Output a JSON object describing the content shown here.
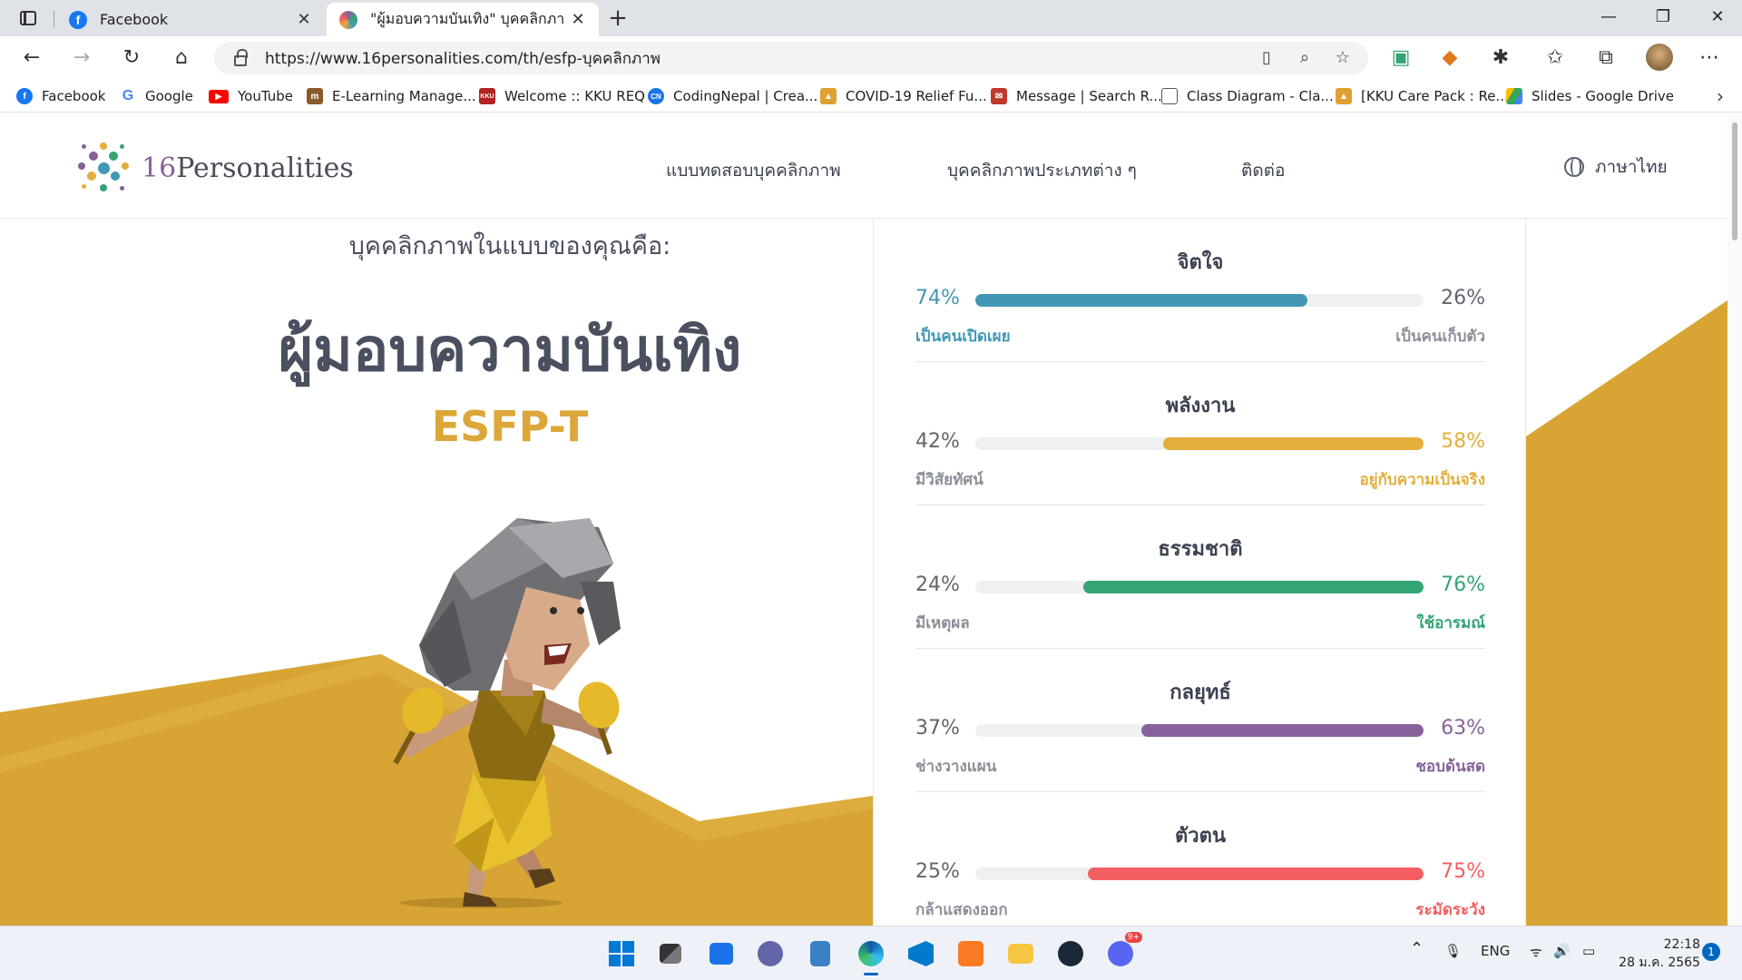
{
  "browser": {
    "tabs": [
      {
        "title": "Facebook",
        "active": false
      },
      {
        "title": "\"ผู้มอบความบันเทิง\" บุคคลิกภาพ (ESF",
        "active": true
      }
    ],
    "address": "https://www.16personalities.com/th/esfp-บุคคลิกภาพ",
    "bookmarks": [
      {
        "label": "Facebook",
        "icon": "facebook-icon",
        "color": "#1877f2"
      },
      {
        "label": "Google",
        "icon": "google-icon",
        "color": "#4285f4"
      },
      {
        "label": "YouTube",
        "icon": "youtube-icon",
        "color": "#ff0000"
      },
      {
        "label": "E-Learning Manage...",
        "icon": "elearning-icon",
        "color": "#8a5a2b"
      },
      {
        "label": "Welcome :: KKU REQ",
        "icon": "kku-req-icon",
        "color": "#b22222"
      },
      {
        "label": "CodingNepal | Crea...",
        "icon": "codingnepal-icon",
        "color": "#1a73e8"
      },
      {
        "label": "COVID-19 Relief Fu...",
        "icon": "covid-relief-icon",
        "color": "#e0a030"
      },
      {
        "label": "Message | Search R...",
        "icon": "message-icon",
        "color": "#c0392b"
      },
      {
        "label": "Class Diagram - Cla...",
        "icon": "document-icon",
        "color": "#666666"
      },
      {
        "label": "[KKU Care Pack : Re...",
        "icon": "kku-care-icon",
        "color": "#e0a030"
      },
      {
        "label": "Slides - Google Drive",
        "icon": "google-drive-icon",
        "color": "#34a853"
      }
    ]
  },
  "site": {
    "logo_number": "16",
    "logo_word": "Personalities",
    "nav": [
      "แบบทดสอบบุคคลิกภาพ",
      "บุคคลิกภาพประเภทต่าง ๆ",
      "ติดต่อ"
    ],
    "language": "ภาษาไทย",
    "intro": "บุคคลิกภาพในแบบของคุณคือ:",
    "type_name": "ผู้มอบความบันเทิง",
    "type_code": "ESFP-T",
    "accent": "#dca639"
  },
  "traits": [
    {
      "title": "จิตใจ",
      "left_pct": "74%",
      "right_pct": "26%",
      "left_label": "เป็นคนเปิดเผย",
      "right_label": "เป็นคนเก็บตัว",
      "fill_side": "left",
      "fill_fraction": 0.74,
      "color": "#4298b4",
      "highlight": "left"
    },
    {
      "title": "พลังงาน",
      "left_pct": "42%",
      "right_pct": "58%",
      "left_label": "มีวิสัยทัศน์",
      "right_label": "อยู่กับความเป็นจริง",
      "fill_side": "right",
      "fill_fraction": 0.58,
      "color": "#e4ae3a",
      "highlight": "right"
    },
    {
      "title": "ธรรมชาติ",
      "left_pct": "24%",
      "right_pct": "76%",
      "left_label": "มีเหตุผล",
      "right_label": "ใช้อารมณ์",
      "fill_side": "right",
      "fill_fraction": 0.76,
      "color": "#33a474",
      "highlight": "right"
    },
    {
      "title": "กลยุทธ์",
      "left_pct": "37%",
      "right_pct": "63%",
      "left_label": "ช่างวางแผน",
      "right_label": "ชอบด้นสด",
      "fill_side": "right",
      "fill_fraction": 0.63,
      "color": "#88619a",
      "highlight": "right"
    },
    {
      "title": "ตัวตน",
      "left_pct": "25%",
      "right_pct": "75%",
      "left_label": "กล้าแสดงออก",
      "right_label": "ระมัดระวัง",
      "fill_side": "right",
      "fill_fraction": 0.75,
      "color": "#f25e62",
      "highlight": "right"
    }
  ],
  "taskbar": {
    "language": "ENG",
    "time": "22:18",
    "date": "28 ม.ค. 2565",
    "notifications": "1",
    "discord_badge": "9+"
  }
}
